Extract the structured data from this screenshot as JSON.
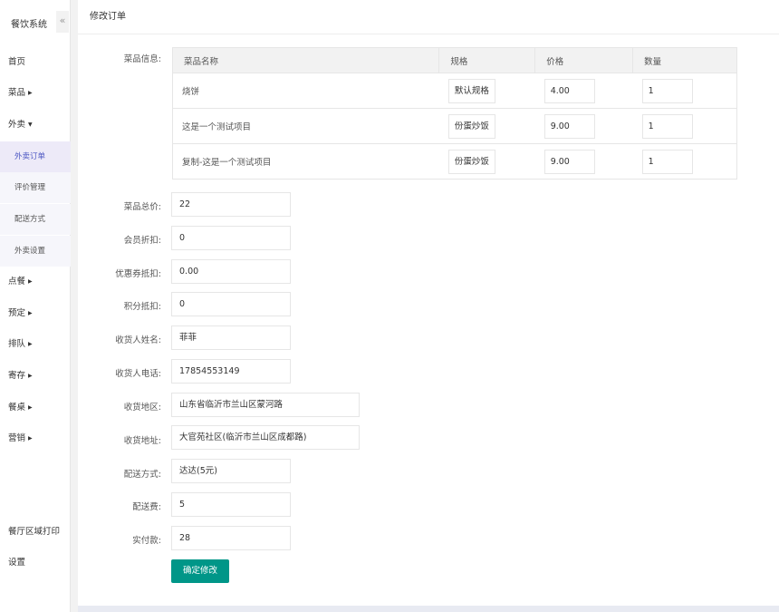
{
  "app": {
    "title": "餐饮系统",
    "collapse_icon": "«"
  },
  "sidebar": {
    "items": [
      {
        "label": "首页",
        "arrow": ""
      },
      {
        "label": "菜品",
        "arrow": "▶"
      },
      {
        "label": "外卖",
        "arrow": "▼"
      },
      {
        "label": "点餐",
        "arrow": "▶"
      },
      {
        "label": "预定",
        "arrow": "▶"
      },
      {
        "label": "排队",
        "arrow": "▶"
      },
      {
        "label": "寄存",
        "arrow": "▶"
      },
      {
        "label": "餐桌",
        "arrow": "▶"
      },
      {
        "label": "营销",
        "arrow": "▶"
      },
      {
        "label": "餐厅区域打印",
        "arrow": ""
      },
      {
        "label": "设置",
        "arrow": ""
      }
    ],
    "sub_items": [
      {
        "label": "外卖订单",
        "active": true
      },
      {
        "label": "评价管理",
        "active": false
      },
      {
        "label": "配送方式",
        "active": false
      },
      {
        "label": "外卖设置",
        "active": false
      }
    ]
  },
  "page": {
    "title": "修改订单"
  },
  "dish_info": {
    "label": "菜品信息:",
    "columns": [
      "菜品名称",
      "规格",
      "价格",
      "数量"
    ],
    "rows": [
      {
        "name": "烧饼",
        "spec": "默认规格",
        "price": "4.00",
        "qty": "1"
      },
      {
        "name": "这是一个测试项目",
        "spec": "份蛋炒饭",
        "price": "9.00",
        "qty": "1"
      },
      {
        "name": "复制-这是一个测试项目",
        "spec": "份蛋炒饭",
        "price": "9.00",
        "qty": "1"
      }
    ]
  },
  "form": {
    "total": {
      "label": "菜品总价:",
      "value": "22"
    },
    "member_discount": {
      "label": "会员折扣:",
      "value": "0"
    },
    "coupon": {
      "label": "优惠券抵扣:",
      "value": "0.00"
    },
    "points": {
      "label": "积分抵扣:",
      "value": "0"
    },
    "receiver_name": {
      "label": "收货人姓名:",
      "value": "菲菲"
    },
    "receiver_phone": {
      "label": "收货人电话:",
      "value": "17854553149"
    },
    "region": {
      "label": "收货地区:",
      "value": "山东省临沂市兰山区蒙河路"
    },
    "address": {
      "label": "收货地址:",
      "value": "大官苑社区(临沂市兰山区成都路)"
    },
    "delivery_method": {
      "label": "配送方式:",
      "value": "达达(5元)"
    },
    "delivery_fee": {
      "label": "配送费:",
      "value": "5"
    },
    "paid": {
      "label": "实付款:",
      "value": "28"
    }
  },
  "submit_label": "确定修改",
  "colors": {
    "primary": "#009688",
    "active_menu": "#4a55c2"
  }
}
